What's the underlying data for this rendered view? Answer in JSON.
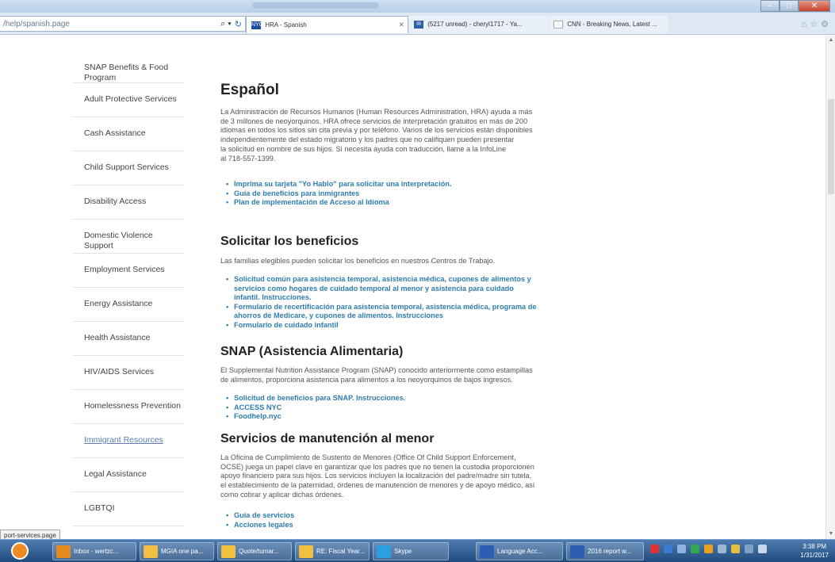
{
  "browser": {
    "url": "/help/spanish.page",
    "tabs": [
      {
        "label": "HRA - Spanish",
        "favicon": "NYC"
      },
      {
        "label": "(5217 unread) - cheryl1717 - Ya...",
        "favicon": "mail"
      },
      {
        "label": "CNN - Breaking News, Latest ...",
        "favicon": "cnn"
      }
    ]
  },
  "sidebar": {
    "items": [
      {
        "label": "SNAP Benefits & Food Program"
      },
      {
        "label": "Adult Protective Services"
      },
      {
        "label": "Cash Assistance"
      },
      {
        "label": "Child Support Services"
      },
      {
        "label": "Disability Access"
      },
      {
        "label": "Domestic Violence Support"
      },
      {
        "label": "Employment Services"
      },
      {
        "label": "Energy Assistance"
      },
      {
        "label": "Health Assistance"
      },
      {
        "label": "HIV/AIDS Services"
      },
      {
        "label": "Homelessness Prevention"
      },
      {
        "label": "Immigrant Resources"
      },
      {
        "label": "Legal Assistance"
      },
      {
        "label": "LGBTQI"
      }
    ]
  },
  "main": {
    "title": "Español",
    "intro_lines": [
      "La Administración de Recursos Humanos (Human Resources Administration, HRA) ayuda a más",
      "de 3 millones de neoyorquinos. HRA ofrece servicios de interpretación gratuitos en más de 200",
      "idiomas en todos los sitios sin cita previa y por teléfono. Varios de los servicios están disponibles",
      "independientemente del estado migratorio y los padres que no califiquen pueden presentar",
      "la solicitud en nombre de sus hijos. Si necesita ayuda con traducción, llame a la InfoLine",
      "al 718-557-1399."
    ],
    "intro_links": [
      "Imprima su tarjeta \"Yo Hablo\" para solicitar una interpretación.",
      "Guía de beneficios para inmigrantes",
      "Plan de implementación de Acceso al Idioma"
    ],
    "apply": {
      "heading": "Solicitar los beneficios",
      "text": "Las familias elegibles pueden solicitar los beneficios en nuestros Centros de Trabajo.",
      "link1_lines": [
        "Solicitud común para asistencia temporal, asistencia médica, cupones de alimentos y",
        "servicios como hogares de cuidado temporal al menor y asistencia para cuidado",
        "infantil. Instrucciones."
      ],
      "link2_lines": [
        "Formulario de recertificación para asistencia temporal, asistencia médica, programa de",
        "ahorros de Medicare, y cupones de alimentos. Instrucciones"
      ],
      "link3": "Formulario de cuidado infantil"
    },
    "snap": {
      "heading": "SNAP (Asistencia Alimentaria)",
      "text_lines": [
        "El Supplemental Nutrition Assistance Program (SNAP) conocido anteriormente como estampillas",
        "de alimentos, proporciona asistencia para alimentos a los neoyorquinos de bajos ingresos."
      ],
      "links": [
        "Solicitud de beneficios para SNAP. Instrucciones.",
        "ACCESS NYC",
        "Foodhelp.nyc"
      ]
    },
    "child_support": {
      "heading": "Servicios de manutención al menor",
      "text_lines": [
        "La Oficina de Cumplimiento de Sustento de Menores (Office Of Child Support Enforcement,",
        "OCSE) juega un papel clave en garantizar que los padres que no tienen la custodia proporcionen",
        "apoyo financiero para sus hijos. Los servicios incluyen la localización del padre/madre sin tutela,",
        "el establecimiento de la paternidad, órdenes de manutención de menores y de apoyo médico, así",
        "como cobrar y aplicar dichas órdenes."
      ],
      "links": [
        "Guía de servicios",
        "Acciones legales"
      ]
    }
  },
  "status_tip": "port-services.page",
  "taskbar": {
    "items": [
      {
        "label": "Inbox - wertzc...",
        "color": "#e38b1e"
      },
      {
        "label": "MGIA one pa...",
        "color": "#f2c040"
      },
      {
        "label": "Quote/tumar...",
        "color": "#f2c040"
      },
      {
        "label": "RE: Fiscal Year...",
        "color": "#f2c040"
      },
      {
        "label": "Skype",
        "color": "#2aa0e3"
      },
      {
        "label": "Language Acc...",
        "color": "#2b5fb3"
      },
      {
        "label": "2016 report w...",
        "color": "#2b5fb3"
      }
    ],
    "time": "3:38 PM",
    "date": "1/31/2017"
  }
}
